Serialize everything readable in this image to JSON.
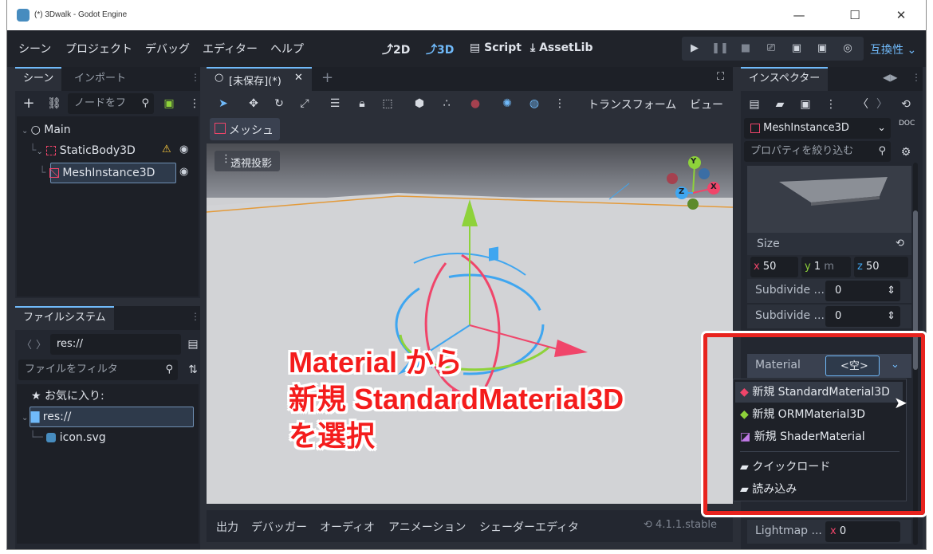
{
  "window": {
    "title": "(*) 3Dwalk - Godot Engine",
    "minimize": "—",
    "maximize": "☐",
    "close": "✕"
  },
  "menu": [
    "シーン",
    "プロジェクト",
    "デバッグ",
    "エディター",
    "ヘルプ"
  ],
  "workspaces": {
    "w2d": "2D",
    "w3d": "3D",
    "script": "Script",
    "assetlib": "AssetLib"
  },
  "renderer": "互換性",
  "scene_dock": {
    "tabs": [
      "シーン",
      "インポート"
    ],
    "filter_placeholder": "ノードをフ",
    "nodes": [
      {
        "name": "Main"
      },
      {
        "name": "StaticBody3D"
      },
      {
        "name": "MeshInstance3D"
      }
    ]
  },
  "filesystem_dock": {
    "tab": "ファイルシステム",
    "path": "res://",
    "filter_placeholder": "ファイルをフィルタ",
    "favorites": "お気に入り:",
    "root": "res://",
    "file": "icon.svg"
  },
  "editor": {
    "scene_tab": "[未保存](*)",
    "toolbar_transform": "トランスフォーム",
    "toolbar_view": "ビュー",
    "mesh_menu": "メッシュ",
    "perspective": "透視投影"
  },
  "gizmo": {
    "x": "X",
    "y": "Y",
    "z": "Z"
  },
  "bottom_panel": {
    "tabs": [
      "出力",
      "デバッガー",
      "オーディオ",
      "アニメーション",
      "シェーダーエディタ"
    ],
    "version": "4.1.1.stable"
  },
  "inspector": {
    "tab": "インスペクター",
    "node": "MeshInstance3D",
    "filter_placeholder": "プロパティを絞り込む",
    "size_label": "Size",
    "size": {
      "x": "50",
      "y": "1",
      "y_unit": "m",
      "z": "50"
    },
    "subdivide_width_label": "Subdivide ...",
    "subdivide_width": "0",
    "subdivide_depth_label": "Subdivide ...",
    "subdivide_depth": "0",
    "material_label": "Material",
    "material_value": "<空>",
    "lightmap_label": "Lightmap ...",
    "lightmap_x": "0"
  },
  "material_menu": [
    "新規 StandardMaterial3D",
    "新規 ORMMaterial3D",
    "新規 ShaderMaterial",
    "クイックロード",
    "読み込み"
  ],
  "annotation": [
    "Material から",
    "新規 StandardMaterial3D",
    "を選択"
  ],
  "colors": {
    "accent": "#70bafa",
    "annotation_red": "#e8231e",
    "x_axis": "#f0456a",
    "y_axis": "#8ed23a",
    "z_axis": "#3fa6f0"
  }
}
